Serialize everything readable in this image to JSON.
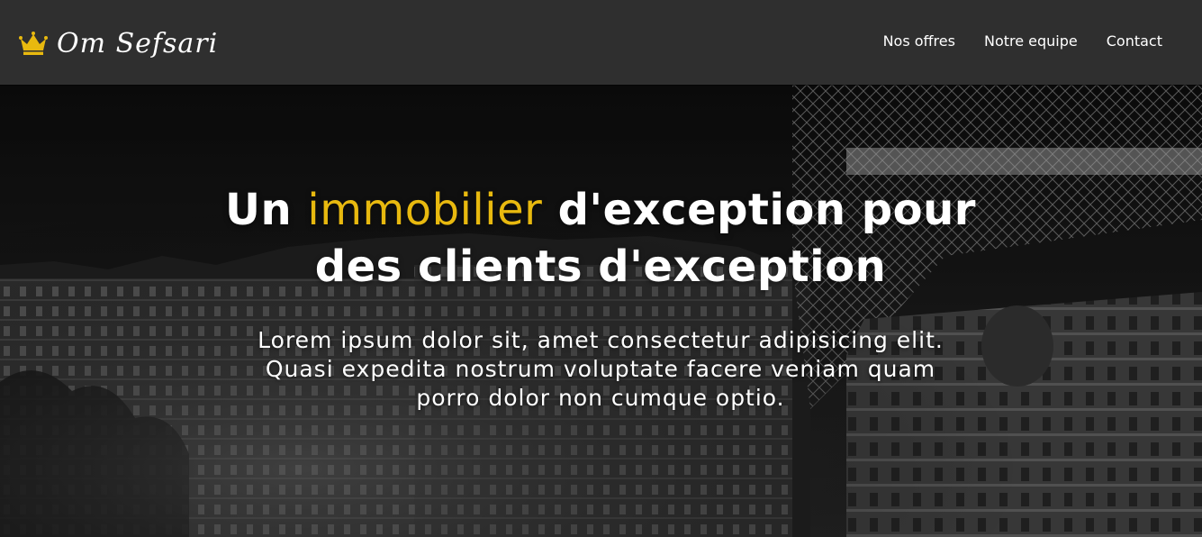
{
  "brand": {
    "name": "Om  Sefsari",
    "icon": "crown-icon",
    "icon_color": "#e8b90f"
  },
  "nav": {
    "items": [
      {
        "label": "Nos offres"
      },
      {
        "label": "Notre equipe"
      },
      {
        "label": "Contact"
      }
    ]
  },
  "hero": {
    "title_start": "Un ",
    "title_highlight": "immobilier",
    "title_end": " d'exception pour des clients d'exception",
    "text": "Lorem ipsum dolor sit, amet consectetur adipisicing elit. Quasi expedita nostrum voluptate facere veniam quam porro dolor non cumque optio.",
    "accent_color": "#e8b90f",
    "background_image": "black-and-white Paris night cityscape with Eiffel Tower"
  },
  "colors": {
    "navbar": "#2f2f2f",
    "text": "#ffffff"
  }
}
